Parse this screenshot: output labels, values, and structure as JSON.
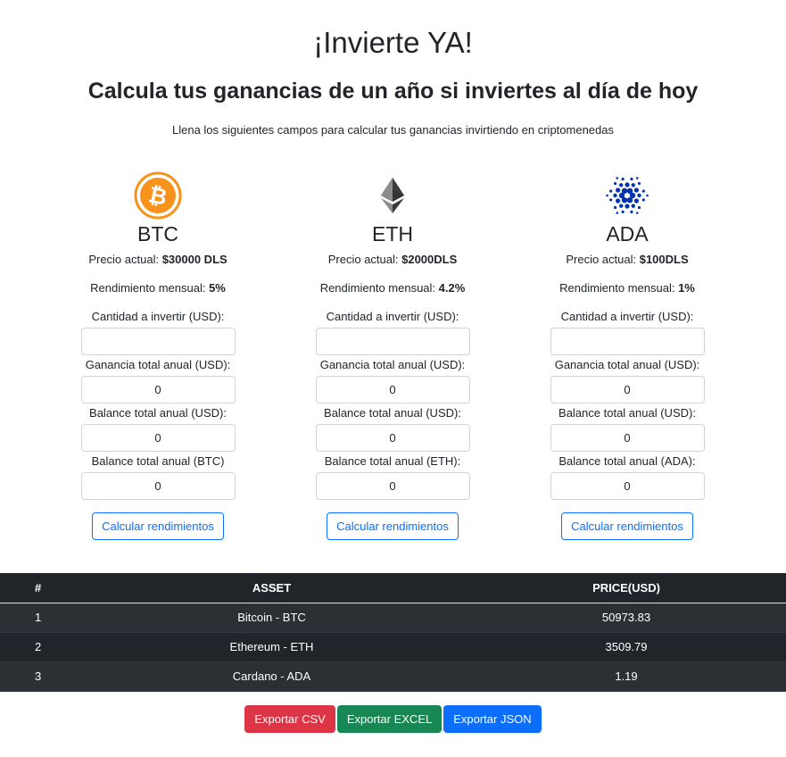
{
  "header": {
    "title": "¡Invierte YA!",
    "subtitle": "Calcula tus ganancias de un año si inviertes al día de hoy",
    "instructions": "Llena los siguientes campos para calcular tus ganancias invirtiendo en criptomenedas"
  },
  "coins": [
    {
      "symbol": "BTC",
      "icon": "bitcoin-icon",
      "price_label": "Precio actual: ",
      "price_value": "$30000 DLS",
      "yield_label": "Rendimiento mensual: ",
      "yield_value": "5%",
      "amount_label": "Cantidad a invertir (USD):",
      "amount_value": "",
      "gain_label": "Ganancia total anual (USD):",
      "gain_value": "0",
      "balance_usd_label": "Balance total anual (USD):",
      "balance_usd_value": "0",
      "balance_coin_label": "Balance total anual (BTC)",
      "balance_coin_value": "0",
      "button_label": "Calcular rendimientos",
      "color": "#f7931a"
    },
    {
      "symbol": "ETH",
      "icon": "ethereum-icon",
      "price_label": "Precio actual: ",
      "price_value": "$2000DLS",
      "yield_label": "Rendimiento mensual: ",
      "yield_value": "4.2%",
      "amount_label": "Cantidad a invertir (USD):",
      "amount_value": "",
      "gain_label": "Ganancia total anual (USD):",
      "gain_value": "0",
      "balance_usd_label": "Balance total anual (USD):",
      "balance_usd_value": "0",
      "balance_coin_label": "Balance total anual (ETH):",
      "balance_coin_value": "0",
      "button_label": "Calcular rendimientos",
      "color": "#3c3c3d"
    },
    {
      "symbol": "ADA",
      "icon": "cardano-icon",
      "price_label": "Precio actual: ",
      "price_value": "$100DLS",
      "yield_label": "Rendimiento mensual: ",
      "yield_value": "1%",
      "amount_label": "Cantidad a invertir (USD):",
      "amount_value": "",
      "gain_label": "Ganancia total anual (USD):",
      "gain_value": "0",
      "balance_usd_label": "Balance total anual (USD):",
      "balance_usd_value": "0",
      "balance_coin_label": "Balance total anual (ADA):",
      "balance_coin_value": "0",
      "button_label": "Calcular rendimientos",
      "color": "#0033ad"
    }
  ],
  "table": {
    "headers": [
      "#",
      "ASSET",
      "PRICE(USD)"
    ],
    "rows": [
      [
        "1",
        "Bitcoin - BTC",
        "50973.83"
      ],
      [
        "2",
        "Ethereum - ETH",
        "3509.79"
      ],
      [
        "3",
        "Cardano - ADA",
        "1.19"
      ]
    ]
  },
  "export": {
    "csv_label": "Exportar CSV",
    "excel_label": "Exportar EXCEL",
    "json_label": "Exportar JSON",
    "csv_color": "#dc3545",
    "excel_color": "#198754",
    "json_color": "#0d6efd"
  }
}
